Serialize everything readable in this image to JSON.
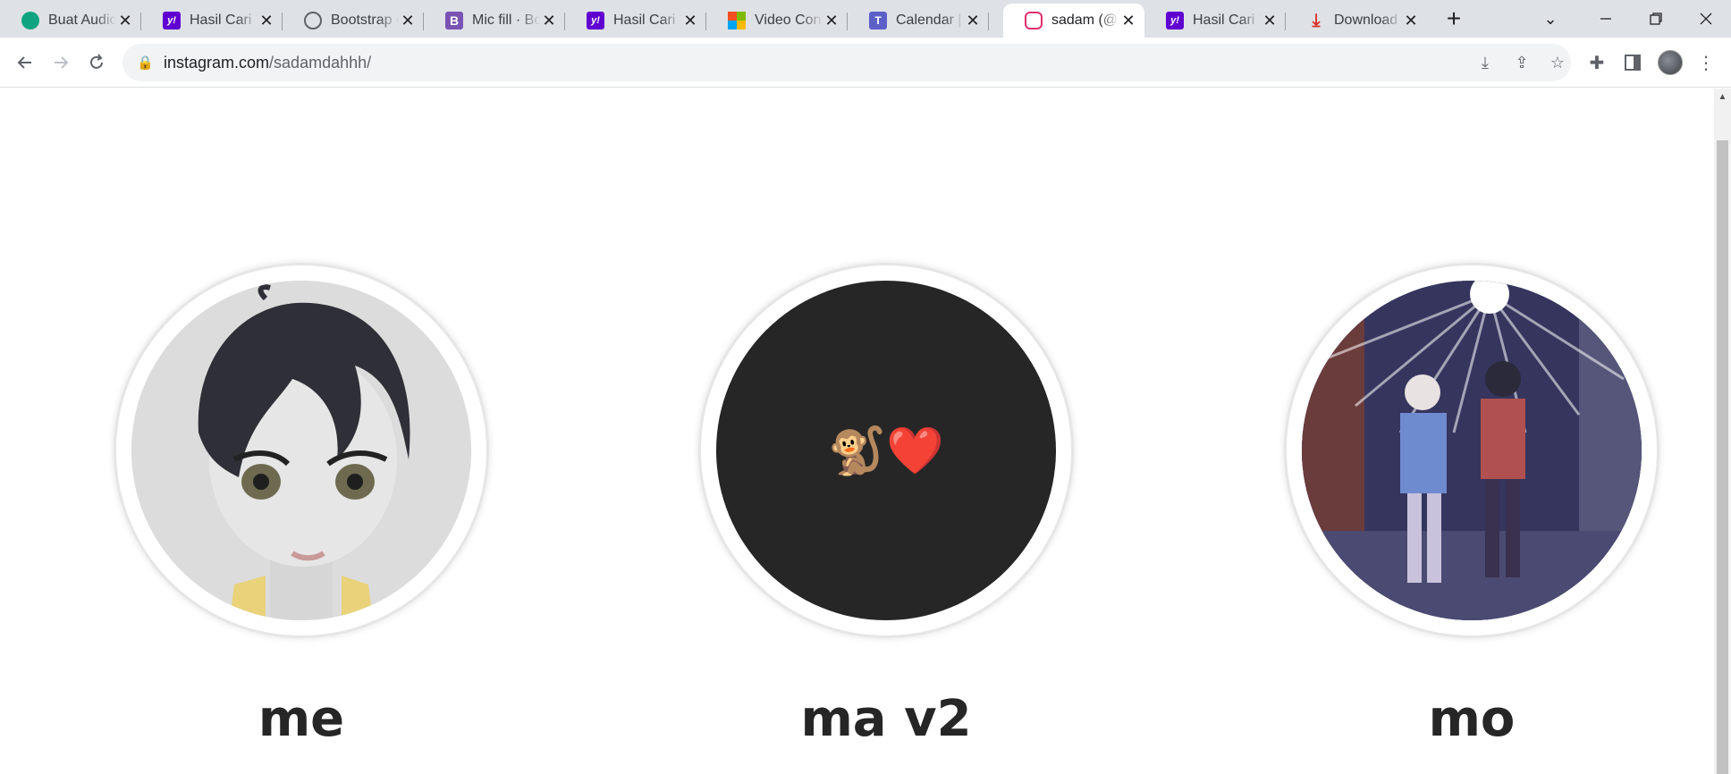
{
  "tabs": [
    {
      "title": "Buat Audio",
      "icon": "chatgpt-icon"
    },
    {
      "title": "Hasil Cari Yahoo",
      "icon": "yahoo-icon"
    },
    {
      "title": "Bootstrap d",
      "icon": "globe-icon"
    },
    {
      "title": "Mic fill · Boo",
      "icon": "bootstrap-icon"
    },
    {
      "title": "Hasil Cari Yahoo",
      "icon": "yahoo-icon"
    },
    {
      "title": "Video Confe",
      "icon": "microsoft-icon"
    },
    {
      "title": "Calendar | M",
      "icon": "teams-icon"
    },
    {
      "title": "sadam (@sa",
      "icon": "instagram-icon",
      "active": true
    },
    {
      "title": "Hasil Cari Yahoo",
      "icon": "yahoo-icon"
    },
    {
      "title": "Download F",
      "icon": "download-icon"
    }
  ],
  "address_bar": {
    "host": "instagram.com",
    "path": "/sadamdahhh/"
  },
  "highlights": [
    {
      "label": "me"
    },
    {
      "label": "ma v2",
      "cover_text": "🐒❤️"
    },
    {
      "label": "mo"
    }
  ],
  "colors": {
    "tab_strip": "#dee1e6",
    "label_text": "#262626",
    "dark_cover": "#262626"
  }
}
